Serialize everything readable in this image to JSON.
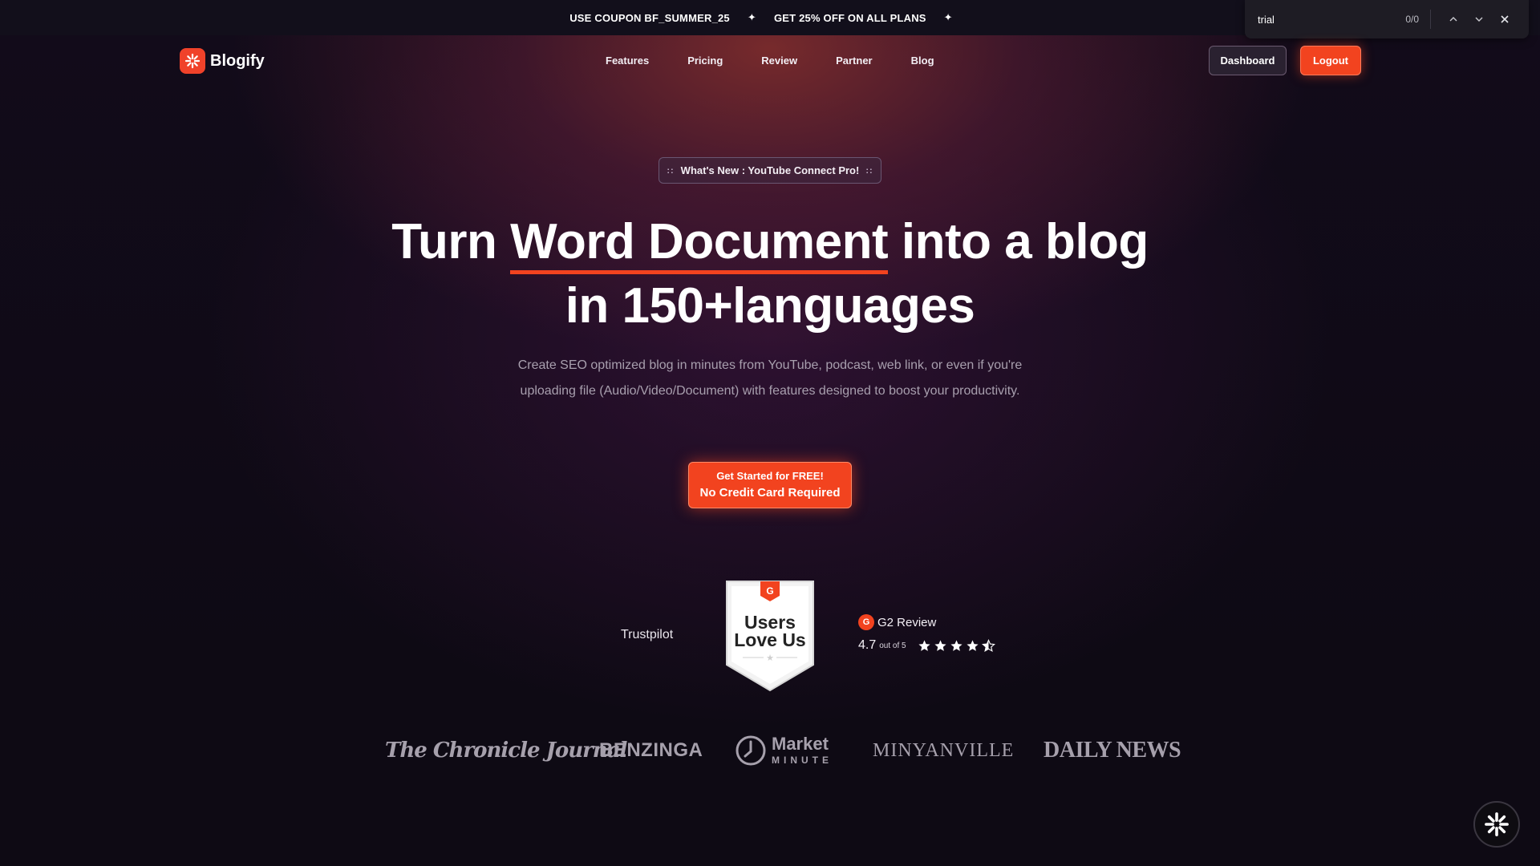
{
  "announcement": {
    "coupon_text": "USE COUPON BF_SUMMER_25",
    "sparkle": "✦",
    "offer_text": "GET 25% OFF ON ALL PLANS"
  },
  "find_bar": {
    "query": "trial",
    "count": "0/0"
  },
  "brand": {
    "name": "Blogify",
    "logo_icon": "blogify-logo-icon",
    "accent": "#f2431f"
  },
  "nav": {
    "items": [
      {
        "label": "Features"
      },
      {
        "label": "Pricing"
      },
      {
        "label": "Review"
      },
      {
        "label": "Partner"
      },
      {
        "label": "Blog"
      }
    ],
    "dashboard_label": "Dashboard",
    "logout_label": "Logout"
  },
  "hero": {
    "pill_text": "What's New : YouTube Connect Pro!",
    "pill_dots": "::",
    "headline_pre": "Turn ",
    "headline_highlight": "Word Document",
    "headline_post": " into a blog",
    "headline_line2": "in 150+languages",
    "subtitle": "Create SEO optimized blog in minutes from YouTube, podcast, web link, or even if you're uploading file (Audio/Video/Document) with features designed to boost your productivity.",
    "cta_top": "Get Started for FREE!",
    "cta_bottom": "No Credit Card Required"
  },
  "social_proof": {
    "trustpilot": "Trustpilot",
    "badge_line1": "Users",
    "badge_line2": "Love Us",
    "g2_label": "G2 Review",
    "g2_logo": "G",
    "rating": "4.7",
    "out_of": "out of 5",
    "stars_value": 4.5
  },
  "press": {
    "chronicle": "The Chronicle Journal",
    "benzinga": "BENZINGA",
    "market_title": "Market",
    "market_sub": "MINUTE",
    "minyanville": "MINYANVILLE",
    "daily_news": "DAILY NEWS"
  }
}
